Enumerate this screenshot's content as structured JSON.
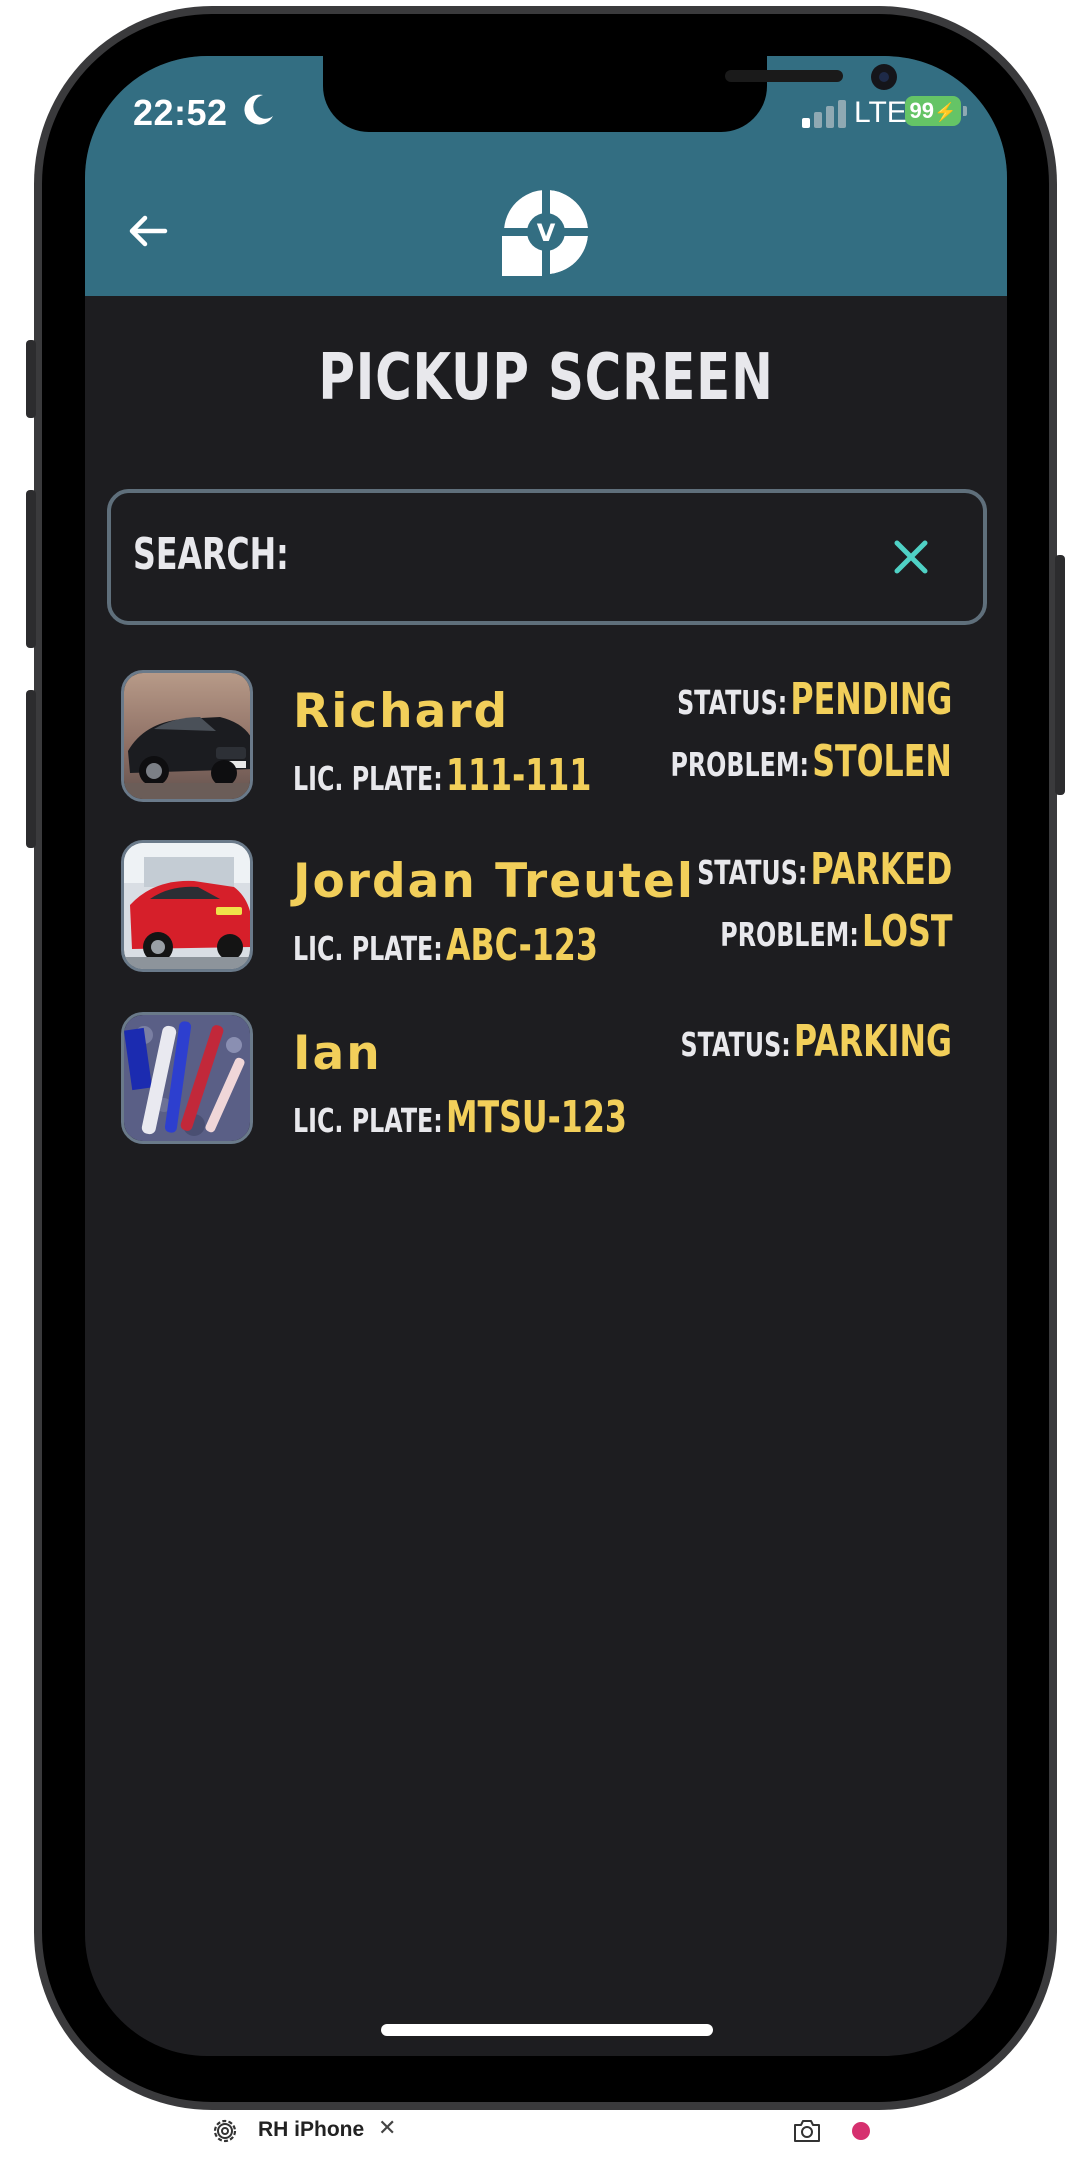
{
  "status_bar": {
    "time": "22:52",
    "network": "LTE",
    "battery": "99"
  },
  "header": {
    "back_icon": "arrow-left-icon",
    "logo_icon": "valet-v-logo",
    "logo_letter": "V",
    "accent_color": "#336e82"
  },
  "page": {
    "title": "PICKUP SCREEN"
  },
  "search": {
    "label": "SEARCH:",
    "value": "",
    "clear_icon": "close-icon",
    "clear_color": "#4fd1c5"
  },
  "labels": {
    "plate": "LIC. PLATE:",
    "status": "STATUS:",
    "problem": "PROBLEM:"
  },
  "pickups": [
    {
      "name": "Richard",
      "plate": "111-111",
      "status": "PENDING",
      "problem": "STOLEN",
      "thumb": "black-car-photo"
    },
    {
      "name": "Jordan Treutel",
      "plate": "ABC-123",
      "status": "PARKED",
      "problem": "LOST",
      "thumb": "red-car-photo"
    },
    {
      "name": "Ian",
      "plate": "MTSU-123",
      "status": "PARKING",
      "problem": "",
      "thumb": "pens-photo"
    }
  ],
  "highlight_color": "#f2cf5a",
  "device_toolbar": {
    "device_name": "RH iPhone",
    "settings_icon": "gear-icon",
    "close_icon": "close-icon",
    "screenshot_icon": "camera-icon",
    "record_icon": "record-dot-icon",
    "record_color": "#d6306f"
  }
}
